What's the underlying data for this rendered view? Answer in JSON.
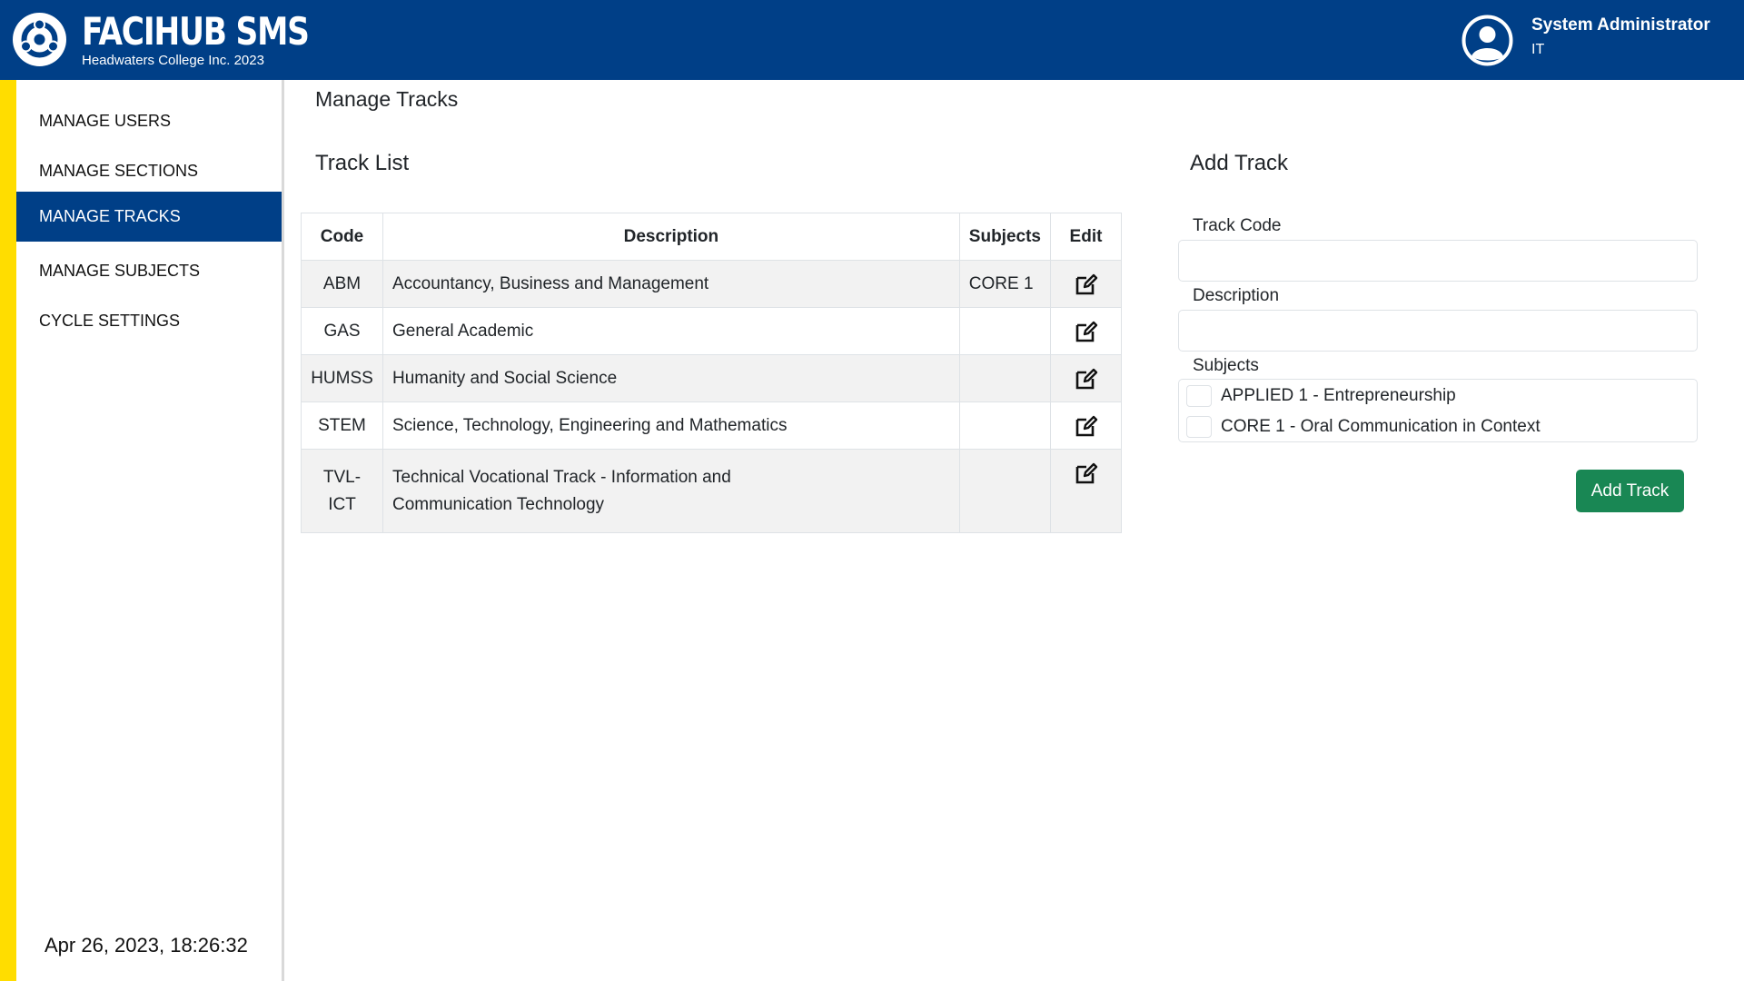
{
  "header": {
    "brand_title": "FACIHUB SMS",
    "brand_subtitle": "Headwaters College Inc. 2023",
    "logo_icon": "college-logo-icon",
    "user_icon": "user-avatar-icon",
    "user_name": "System Administrator",
    "user_department": "IT",
    "colors": {
      "header_bg": "#003f87",
      "accent_strip": "#ffdd00",
      "active_nav": "#003f87",
      "button": "#198754"
    }
  },
  "sidebar": {
    "items": [
      {
        "label": "MANAGE USERS"
      },
      {
        "label": "MANAGE SECTIONS"
      },
      {
        "label": "MANAGE TRACKS",
        "active": true
      },
      {
        "label": "MANAGE SUBJECTS"
      },
      {
        "label": "CYCLE SETTINGS"
      }
    ],
    "clock": "Apr 26, 2023, 18:26:32"
  },
  "main": {
    "page_title": "Manage Tracks",
    "track_list": {
      "title": "Track List",
      "columns": [
        "Code",
        "Description",
        "Subjects",
        "Edit"
      ],
      "edit_icon": "edit-icon",
      "rows": [
        {
          "code": "ABM",
          "description": "Accountancy, Business and Management",
          "subjects": "CORE 1"
        },
        {
          "code": "GAS",
          "description": "General Academic",
          "subjects": ""
        },
        {
          "code": "HUMSS",
          "description": "Humanity and Social Science",
          "subjects": ""
        },
        {
          "code": "STEM",
          "description": "Science, Technology, Engineering and Mathematics",
          "subjects": ""
        },
        {
          "code": "TVL-\nICT",
          "description": "Technical Vocational Track - Information and Communication Technology",
          "subjects": ""
        }
      ]
    },
    "add_track": {
      "title": "Add Track",
      "track_code_label": "Track Code",
      "track_code_value": "",
      "description_label": "Description",
      "description_value": "",
      "subjects_label": "Subjects",
      "subject_options": [
        {
          "label": "APPLIED 1 - Entrepreneurship",
          "checked": false
        },
        {
          "label": "CORE 1 - Oral Communication in Context",
          "checked": false
        }
      ],
      "submit_label": "Add Track"
    }
  }
}
